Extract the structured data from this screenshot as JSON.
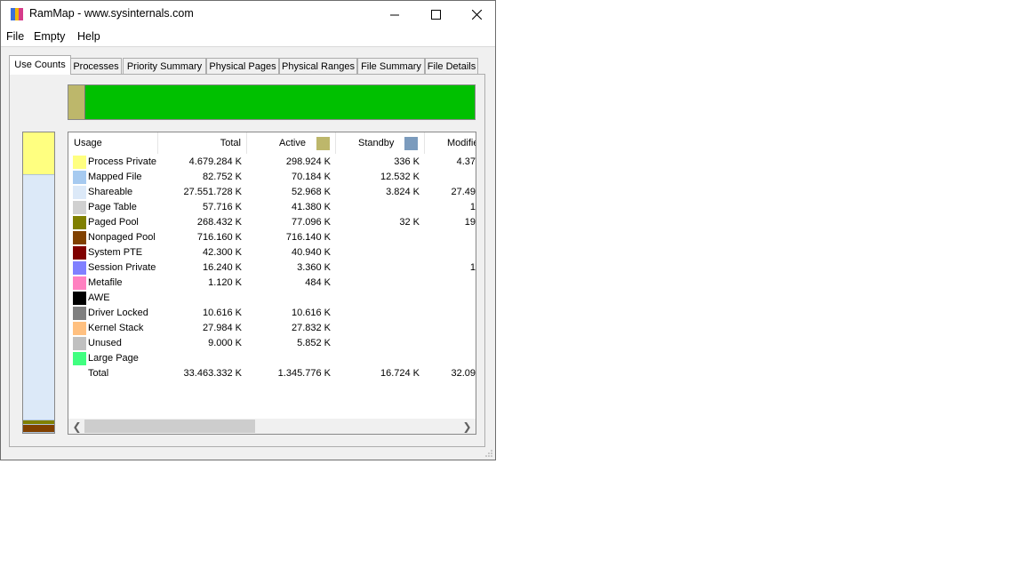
{
  "window": {
    "title": "RamMap - www.sysinternals.com",
    "icon_colors": [
      "#3b6fd9",
      "#f2b705",
      "#d63b8b"
    ]
  },
  "menu": [
    "File",
    "Empty",
    "Help"
  ],
  "tabs": [
    {
      "label": "Use Counts",
      "active": true
    },
    {
      "label": "Processes",
      "active": false
    },
    {
      "label": "Priority Summary",
      "active": false
    },
    {
      "label": "Physical Pages",
      "active": false
    },
    {
      "label": "Physical Ranges",
      "active": false
    },
    {
      "label": "File Summary",
      "active": false
    },
    {
      "label": "File Details",
      "active": false
    }
  ],
  "columns": {
    "usage": "Usage",
    "total": "Total",
    "active": "Active",
    "active_color": "#bdb76b",
    "standby": "Standby",
    "standby_color": "#7b9bbd",
    "modified": "Modifie"
  },
  "rows": [
    {
      "label": "Process Private",
      "color": "#ffff80",
      "total": "4.679.284 K",
      "active": "298.924 K",
      "standby": "336 K",
      "modified": "4.37"
    },
    {
      "label": "Mapped File",
      "color": "#a6caf0",
      "total": "82.752 K",
      "active": "70.184 K",
      "standby": "12.532 K",
      "modified": ""
    },
    {
      "label": "Shareable",
      "color": "#dce9f8",
      "total": "27.551.728 K",
      "active": "52.968 K",
      "standby": "3.824 K",
      "modified": "27.49"
    },
    {
      "label": "Page Table",
      "color": "#d0d0d0",
      "total": "57.716 K",
      "active": "41.380 K",
      "standby": "",
      "modified": "1"
    },
    {
      "label": "Paged Pool",
      "color": "#808000",
      "total": "268.432 K",
      "active": "77.096 K",
      "standby": "32 K",
      "modified": "19"
    },
    {
      "label": "Nonpaged Pool",
      "color": "#804000",
      "total": "716.160 K",
      "active": "716.140 K",
      "standby": "",
      "modified": ""
    },
    {
      "label": "System PTE",
      "color": "#800000",
      "total": "42.300 K",
      "active": "40.940 K",
      "standby": "",
      "modified": ""
    },
    {
      "label": "Session Private",
      "color": "#8080ff",
      "total": "16.240 K",
      "active": "3.360 K",
      "standby": "",
      "modified": "1"
    },
    {
      "label": "Metafile",
      "color": "#ff80c0",
      "total": "1.120 K",
      "active": "484 K",
      "standby": "",
      "modified": ""
    },
    {
      "label": "AWE",
      "color": "#000000",
      "total": "",
      "active": "",
      "standby": "",
      "modified": ""
    },
    {
      "label": "Driver Locked",
      "color": "#808080",
      "total": "10.616 K",
      "active": "10.616 K",
      "standby": "",
      "modified": ""
    },
    {
      "label": "Kernel Stack",
      "color": "#ffc080",
      "total": "27.984 K",
      "active": "27.832 K",
      "standby": "",
      "modified": ""
    },
    {
      "label": "Unused",
      "color": "#c0c0c0",
      "total": "9.000 K",
      "active": "5.852 K",
      "standby": "",
      "modified": ""
    },
    {
      "label": "Large Page",
      "color": "#40ff80",
      "total": "",
      "active": "",
      "standby": "",
      "modified": ""
    }
  ],
  "total_row": {
    "label": "Total",
    "total": "33.463.332 K",
    "active": "1.345.776 K",
    "standby": "16.724 K",
    "modified": "32.09"
  },
  "top_bar": [
    {
      "name": "active",
      "color": "#bdb76b",
      "fraction": 0.04
    },
    {
      "name": "free",
      "color": "#00c000",
      "fraction": 0.96
    }
  ],
  "side_bar": [
    {
      "name": "process-private",
      "color": "#ffff80",
      "fraction": 0.14
    },
    {
      "name": "shareable",
      "color": "#dce9f8",
      "fraction": 0.825
    },
    {
      "name": "paged-pool",
      "color": "#808000",
      "fraction": 0.01
    },
    {
      "name": "nonpaged-pool",
      "color": "#804000",
      "fraction": 0.025
    }
  ]
}
